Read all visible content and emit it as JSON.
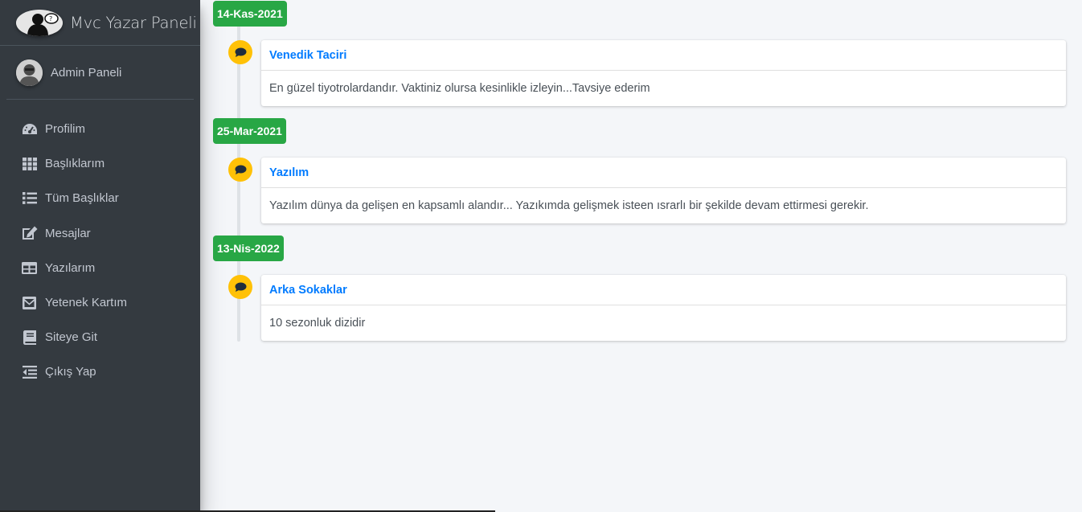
{
  "brand": {
    "title": "Mvc Yazar Paneli"
  },
  "user": {
    "name": "Admin Paneli"
  },
  "nav": [
    {
      "label": "Profilim",
      "icon": "tachometer-icon"
    },
    {
      "label": "Başlıklarım",
      "icon": "grid-icon"
    },
    {
      "label": "Tüm Başlıklar",
      "icon": "list-icon"
    },
    {
      "label": "Mesajlar",
      "icon": "edit-icon"
    },
    {
      "label": "Yazılarım",
      "icon": "table-icon"
    },
    {
      "label": "Yetenek Kartım",
      "icon": "envelope-icon"
    },
    {
      "label": "Siteye Git",
      "icon": "book-icon"
    },
    {
      "label": "Çıkış Yap",
      "icon": "outdent-icon"
    }
  ],
  "timeline": [
    {
      "date": "14-Kas-2021",
      "title": "Venedik Taciri",
      "body": "En güzel tiyotrolardandır. Vaktiniz olursa kesinlikle izleyin...Tavsiye ederim",
      "icon": "comment-icon"
    },
    {
      "date": "25-Mar-2021",
      "title": "Yazılım",
      "body": "Yazılım dünya da gelişen en kapsamlı alandır... Yazıkımda gelişmek isteen ısrarlı bir şekilde devam ettirmesi gerekir.",
      "icon": "comment-icon"
    },
    {
      "date": "13-Nis-2022",
      "title": "Arka Sokaklar",
      "body": "10 sezonluk dizidir",
      "icon": "comment-icon"
    }
  ],
  "colors": {
    "sidebar_bg": "#343a40",
    "content_bg": "#f4f6f9",
    "date_badge": "#28a745",
    "comment_icon_bg": "#ffc107",
    "link": "#007bff"
  }
}
